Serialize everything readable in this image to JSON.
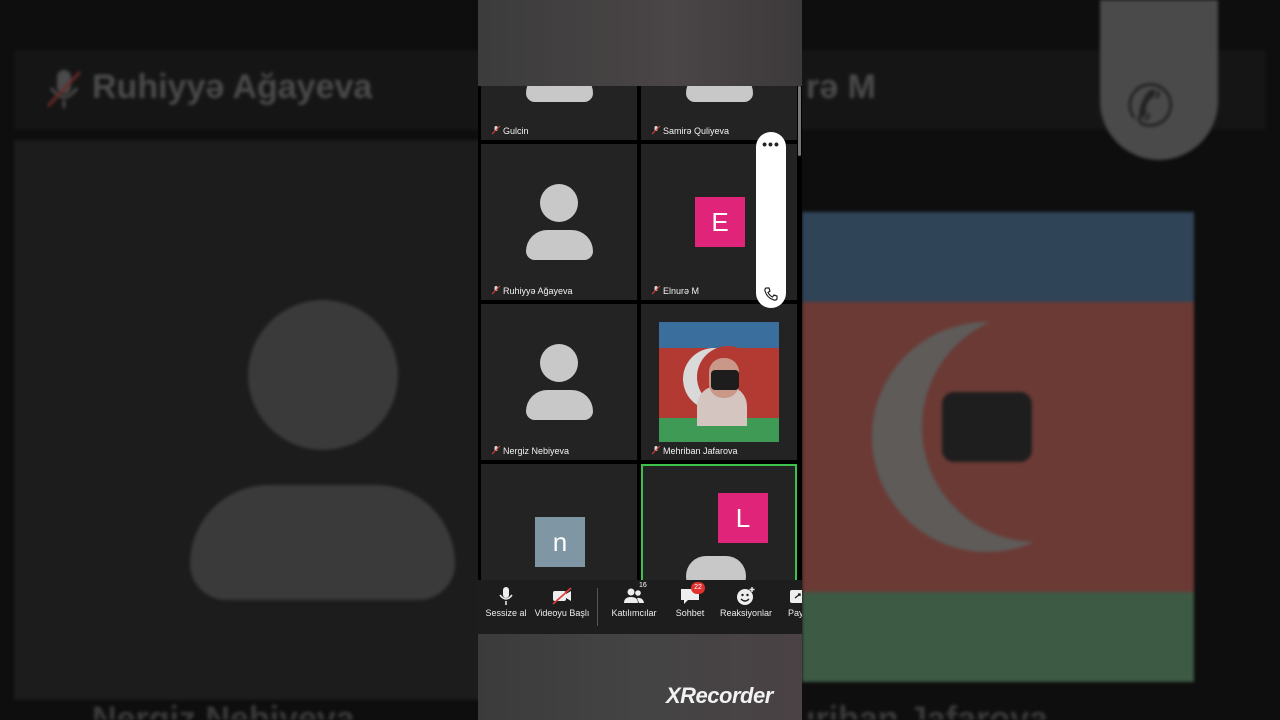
{
  "background": {
    "name_top_left": "Ruhiyyə Ağayeva",
    "name_top_right": "rə M",
    "name_bottom_left": "Nergiz Nebiyeva",
    "name_bottom_right": "ıriban Jafarova"
  },
  "participants": [
    {
      "name": "Gulcin",
      "avatar": "person-silhouette"
    },
    {
      "name": "Samirə Quliyeva",
      "avatar": "person-silhouette"
    },
    {
      "name": "Ruhiyyə Ağayeva",
      "avatar": "person-silhouette"
    },
    {
      "name": "Elnurə M",
      "avatar": "initial",
      "initial": "E",
      "color": "#e0247a"
    },
    {
      "name": "Nergiz Nebiyeva",
      "avatar": "person-silhouette"
    },
    {
      "name": "Mehriban Jafarova",
      "avatar": "photo-flag-camera"
    },
    {
      "name": "",
      "avatar": "initial",
      "initial": "n",
      "color": "#7f97a4"
    },
    {
      "name": "",
      "avatar": "initial",
      "initial": "L",
      "color": "#e0247a",
      "active_speaker": true
    }
  ],
  "floating_controls": {
    "more_icon": "more-horizontal-icon",
    "call_icon": "phone-icon"
  },
  "toolbar": {
    "mute_label": "Sessize al",
    "video_label": "Videoyu Başlı",
    "participants_label": "Katılımcılar",
    "participants_count": "16",
    "chat_label": "Sohbet",
    "chat_badge": "22",
    "reactions_label": "Reaksiyonlar",
    "share_label": "Pay"
  },
  "watermark": "XRecorder",
  "colors": {
    "accent_pink": "#e0247a",
    "active_speaker_border": "#3ec14a",
    "badge_red": "#e0312f"
  }
}
